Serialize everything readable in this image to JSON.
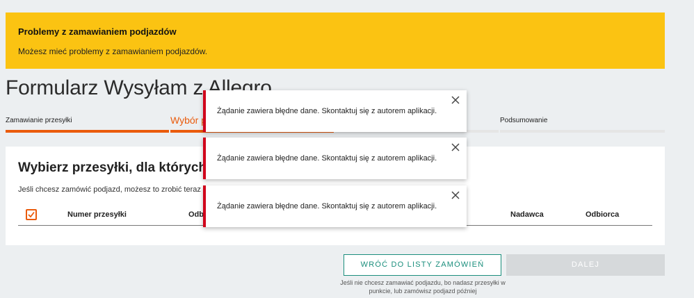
{
  "banner": {
    "title": "Problemy z zamawianiem podjazdów",
    "text": "Możesz mieć problemy z zamawianiem podjazdów."
  },
  "page": {
    "title": "Formularz Wysyłam z Allegro"
  },
  "steps": [
    {
      "label": "Zamawianie przesyłki",
      "status": "done"
    },
    {
      "label": "Wybór p",
      "status": "active"
    },
    {
      "label": "",
      "status": "pending"
    },
    {
      "label": "Podsumowanie",
      "status": "pending"
    }
  ],
  "card": {
    "title": "Wybierz przesyłki, dla których c",
    "description": "Jeśli chcesz zamówić podjazd, możesz to zrobić teraz l",
    "columns": [
      "Numer przesyłki",
      "Odb",
      "Nadawca",
      "Odbiorca"
    ]
  },
  "toasts": [
    {
      "text": "Żądanie zawiera błędne dane. Skontaktuj się z autorem aplikacji."
    },
    {
      "text": "Żądanie zawiera błędne dane. Skontaktuj się z autorem aplikacji."
    },
    {
      "text": "Żądanie zawiera błędne dane. Skontaktuj się z autorem aplikacji."
    }
  ],
  "actions": {
    "back_label": "WRÓĆ DO LISTY ZAMÓWIEŃ",
    "next_label": "DALEJ",
    "hint": "Jeśli nie chcesz zamawiać podjazdu, bo nadasz przesyłki w punkcie, lub zamówisz podjazd później"
  },
  "colors": {
    "banner": "#fbc312",
    "accent": "#ea5b0c",
    "primary_button": "#1a8e7c",
    "error": "#d0021b"
  },
  "icons": {
    "close": "close-icon",
    "checkbox": "checkmark-icon"
  }
}
